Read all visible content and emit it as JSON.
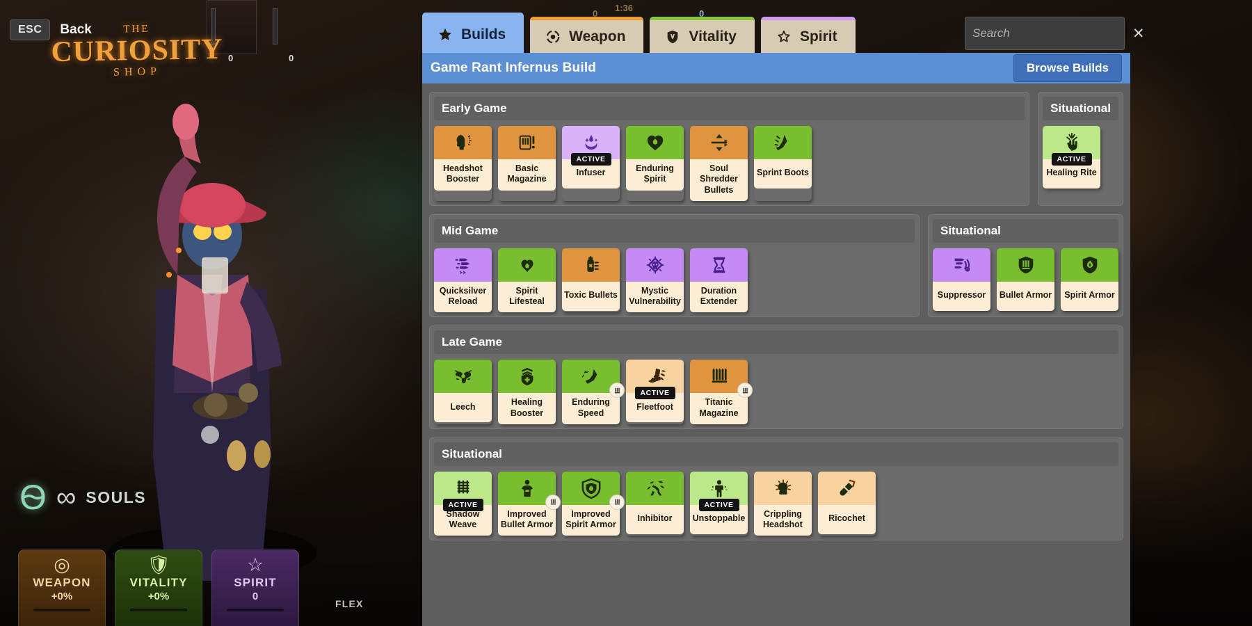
{
  "hud": {
    "esc_key": "ESC",
    "back_label": "Back",
    "logo_the": "THE",
    "logo_main": "CURIOSITY",
    "logo_shop": "SHOP",
    "souls_label": "SOULS",
    "souls_value": "∞",
    "flex_label": "FLEX",
    "faded_text": "...",
    "hud_values": {
      "left_count": "0",
      "right_count": "0",
      "timer": "1:36",
      "gold_left": "0",
      "gold_right": "0"
    },
    "pillars": [
      {
        "name": "WEAPON",
        "value": "+0%",
        "icon": "target-icon"
      },
      {
        "name": "VITALITY",
        "value": "+0%",
        "icon": "shield-icon"
      },
      {
        "name": "SPIRIT",
        "value": "0",
        "icon": "star-icon"
      }
    ]
  },
  "tabs": [
    {
      "label": "Builds",
      "icon": "star-icon",
      "active": true,
      "accent": "#8ab4ef"
    },
    {
      "label": "Weapon",
      "icon": "target-icon",
      "active": false,
      "accent": "#f0a030"
    },
    {
      "label": "Vitality",
      "icon": "shield-icon",
      "active": false,
      "accent": "#8bc63f"
    },
    {
      "label": "Spirit",
      "icon": "star-outline-icon",
      "active": false,
      "accent": "#ce9bf0"
    }
  ],
  "search": {
    "placeholder": "Search",
    "value": "",
    "clear_icon": "close-icon"
  },
  "build_bar": {
    "title": "Game Rant Infernus Build",
    "browse_label": "Browse Builds"
  },
  "sections": [
    {
      "title": "Early Game",
      "items": [
        {
          "name": "Headshot Booster",
          "art": "art-orange",
          "icon": "head-impact-icon",
          "badge": null
        },
        {
          "name": "Basic Magazine",
          "art": "art-orange",
          "icon": "magazine-icon",
          "badge": null
        },
        {
          "name": "Infuser",
          "art": "art-lpurple",
          "icon": "infuser-icon",
          "badge": "ACTIVE"
        },
        {
          "name": "Enduring Spirit",
          "art": "art-green",
          "icon": "heart-spirit-icon",
          "badge": null
        },
        {
          "name": "Soul Shredder Bullets",
          "art": "art-orange",
          "icon": "updown-arrows-icon",
          "badge": null
        },
        {
          "name": "Sprint Boots",
          "art": "art-green",
          "icon": "boot-speed-icon",
          "badge": null
        }
      ],
      "side": {
        "title": "Situational",
        "items": [
          {
            "name": "Healing Rite",
            "art": "art-lgreen",
            "icon": "healing-hand-icon",
            "badge": "ACTIVE"
          }
        ]
      }
    },
    {
      "title": "Mid Game",
      "items": [
        {
          "name": "Quicksilver Reload",
          "art": "art-purple",
          "icon": "fast-bullets-icon",
          "badge": null
        },
        {
          "name": "Spirit Lifesteal",
          "art": "art-green",
          "icon": "heart-drop-icon",
          "badge": null
        },
        {
          "name": "Toxic Bullets",
          "art": "art-orange",
          "icon": "toxic-bottle-icon",
          "badge": null
        },
        {
          "name": "Mystic Vulnerability",
          "art": "art-purple",
          "icon": "skull-diamond-icon",
          "badge": null
        },
        {
          "name": "Duration Extender",
          "art": "art-purple",
          "icon": "hourglass-icon",
          "badge": null
        }
      ],
      "side": {
        "title": "Situational",
        "items": [
          {
            "name": "Suppressor",
            "art": "art-purple",
            "icon": "suppress-waves-icon",
            "badge": null
          },
          {
            "name": "Bullet Armor",
            "art": "art-green",
            "icon": "shield-magazine-icon",
            "badge": null
          },
          {
            "name": "Spirit Armor",
            "art": "art-green",
            "icon": "shield-spirit-icon",
            "badge": null
          }
        ]
      }
    },
    {
      "title": "Late Game",
      "items": [
        {
          "name": "Leech",
          "art": "art-green",
          "icon": "leech-hands-icon",
          "badge": null
        },
        {
          "name": "Healing Booster",
          "art": "art-green",
          "icon": "shield-cross-icon",
          "badge": null
        },
        {
          "name": "Enduring Speed",
          "art": "art-green",
          "icon": "winged-boot-icon",
          "badge": "corner"
        },
        {
          "name": "Fleetfoot",
          "art": "art-lorange",
          "icon": "winged-shoe-icon",
          "badge": "ACTIVE"
        },
        {
          "name": "Titanic Magazine",
          "art": "art-orange",
          "icon": "big-magazine-icon",
          "badge": "corner"
        }
      ],
      "side": null
    },
    {
      "title": "Situational",
      "items": [
        {
          "name": "Shadow Weave",
          "art": "art-lgreen",
          "icon": "shadow-weave-icon",
          "badge": "ACTIVE"
        },
        {
          "name": "Improved Bullet Armor",
          "art": "art-green",
          "icon": "bullet-armor-icon",
          "badge": "corner"
        },
        {
          "name": "Improved Spirit Armor",
          "art": "art-green",
          "icon": "spirit-armor-icon",
          "badge": "corner"
        },
        {
          "name": "Inhibitor",
          "art": "art-green",
          "icon": "inhibitor-icon",
          "badge": null
        },
        {
          "name": "Unstoppable",
          "art": "art-lgreen",
          "icon": "unstoppable-icon",
          "badge": "ACTIVE"
        },
        {
          "name": "Crippling Headshot",
          "art": "art-lorange",
          "icon": "crippling-head-icon",
          "badge": null
        },
        {
          "name": "Ricochet",
          "art": "art-lorange",
          "icon": "ricochet-icon",
          "badge": null
        }
      ],
      "side": null
    }
  ]
}
